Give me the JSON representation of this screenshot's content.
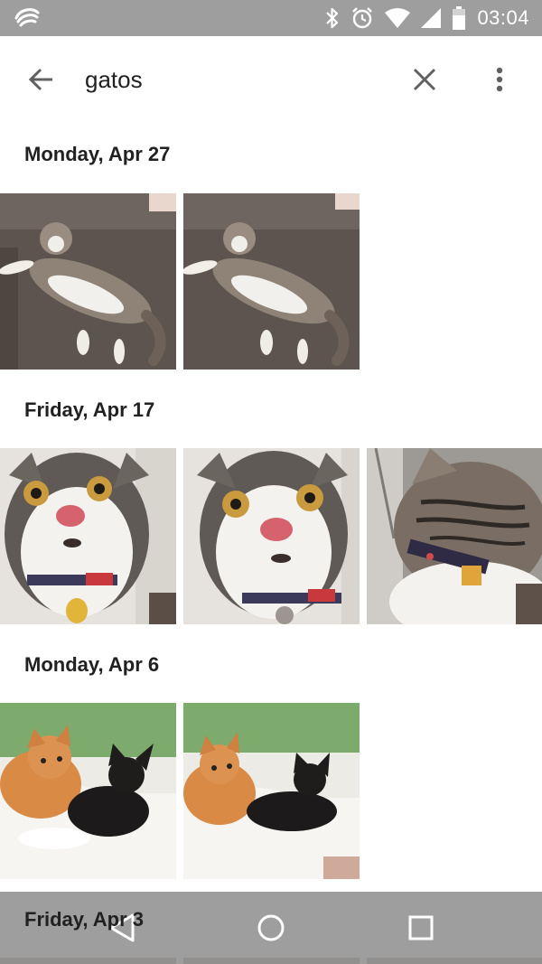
{
  "status_bar": {
    "time": "03:04",
    "icons": [
      "swiftkey-icon",
      "bluetooth-icon",
      "alarm-icon",
      "wifi-icon",
      "signal-icon",
      "battery-icon"
    ]
  },
  "search": {
    "query": "gatos",
    "back_icon": "arrow-back-icon",
    "clear_icon": "close-icon",
    "more_icon": "more-vert-icon"
  },
  "sections": [
    {
      "date": "Monday, Apr 27",
      "photo_count": 2
    },
    {
      "date": "Friday, Apr 17",
      "photo_count": 3
    },
    {
      "date": "Monday, Apr 6",
      "photo_count": 2
    },
    {
      "date": "Friday, Apr 3",
      "photo_count": 3
    }
  ],
  "nav_bar": {
    "icons": [
      "nav-back-icon",
      "nav-home-icon",
      "nav-recents-icon"
    ]
  },
  "colors": {
    "status_bar": "#9e9e9e",
    "text_primary": "#212121",
    "icon_grey": "#616161",
    "nav_bar": "#969696"
  }
}
